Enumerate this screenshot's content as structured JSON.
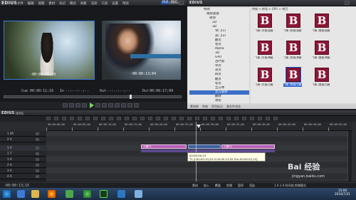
{
  "app": {
    "logo": "EDIUS",
    "menu": [
      "文件",
      "编辑",
      "视图",
      "素材",
      "标记",
      "模式",
      "采集",
      "渲染",
      "工具",
      "设置",
      "帮助"
    ],
    "badge": "PLR",
    "badge2": "REC",
    "logo2": "EDIUS"
  },
  "player": {
    "overlay_tc_left": "-00:00:10;20",
    "overlay_tc_right": "-00:00:13;04",
    "cue": "Cue 00:00:11;16",
    "in_label": "In",
    "in_tc": "--:--:--;--",
    "out_label": "Out",
    "out_tc": "--:--:--;--",
    "dur_label": "Dur",
    "dur_tc": "00:00:17;08",
    "dur2_tc": "00:00:17;09"
  },
  "effects": {
    "tree": [
      "特效",
      "视频滤镜",
      "转场",
      "2D",
      "3D",
      "单门(1)",
      "双门(2)",
      "翻页",
      "卷页",
      "Alpha",
      "3D",
      "GPU",
      "百叶窗",
      "单页",
      "双页",
      "四页",
      "翻页",
      "卷页",
      "立方体",
      "立方旋转",
      "翻转",
      "球化",
      "扭曲",
      "波浪",
      "其他",
      "色彩校正",
      "SMPTE",
      "飞入",
      "音频滤镜"
    ],
    "selected_index": 19,
    "bin_path": "特效 > 转场 > GPU > 单页",
    "thumb_glyph": "B",
    "thumbs": [
      "飞离 (中速)蓝格",
      "飞离 (快速)蓝格",
      "飞离 (慢速)蓝格",
      "飞离 (中速)黑格",
      "飞离 (快速)黑格",
      "飞离 (慢速)黑格",
      "飞离 (中速)白格",
      "飞离 (快速)白格",
      "飞离 (慢速)白格"
    ],
    "selected_thumb": 7,
    "tabs": [
      "素材库",
      "特效",
      "序列标记",
      "源文件浏览"
    ]
  },
  "timeline": {
    "sequence": "序列1",
    "ruler_labels": [
      "00:00:00;00",
      "00:00:05;00",
      "00:00:10;00",
      "00:00:15;00",
      "00:00:20;00",
      "00:00:25;00",
      "00:00:30;00",
      "00:00:35;00",
      "00:00:40;00",
      "00:00:45;00",
      "00:00:50;00",
      "00:00:55;00"
    ],
    "tracks": [
      "1 VA",
      "2 V",
      "1 V",
      "1 T",
      "1 A",
      "2 A",
      "3 A",
      "4 A"
    ],
    "clip1": "人像01",
    "clip2": "人像02",
    "clip3": "人像03",
    "tooltip_line1": "00:00:00;13",
    "tooltip_line2": "T1 [I:00:00:10;20 O:00:00:13;05 Dur:00:00:02;15]"
  },
  "status": {
    "left_tc": "-00:00:13;15",
    "items": [
      "素材",
      "插入",
      "覆盖",
      "剪辑",
      "暂停",
      "渲染"
    ],
    "right": "1 A    1 A  时间线 剪辑模式"
  },
  "taskbar": {
    "clock": "15:00",
    "date": "2016/7/21"
  },
  "watermark": {
    "brand": "Bai 经验",
    "url": "jingyan.baidu.com"
  }
}
